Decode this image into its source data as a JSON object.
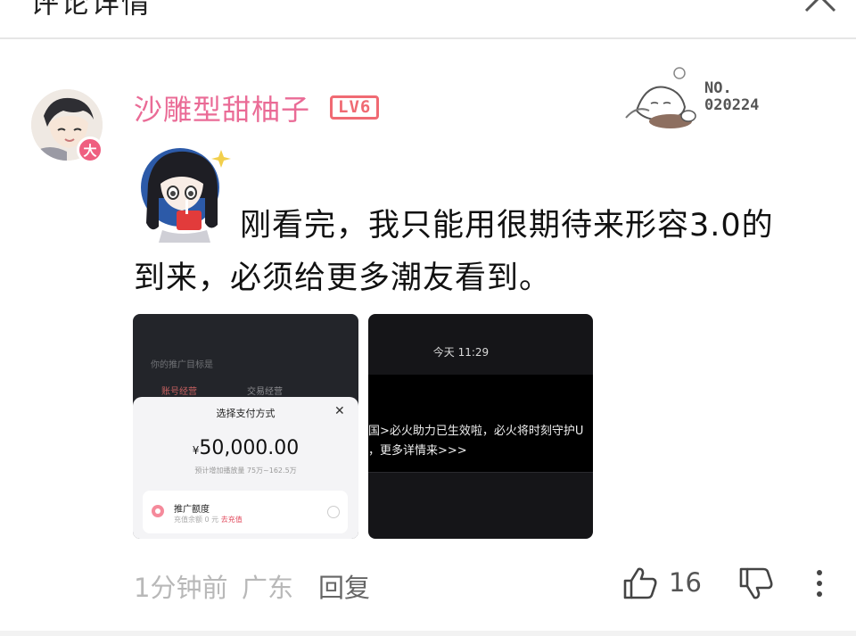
{
  "header": {
    "title": "评论详情"
  },
  "comment": {
    "user": {
      "name": "沙雕型甜柚子",
      "level": "LV6",
      "badge": "大"
    },
    "fan_badge": {
      "line1": "NO.",
      "line2": "020224"
    },
    "text_line1": "刚看完，我只能用很期待来形容3.0的",
    "text_line2": "到来，必须给更多潮友看到。",
    "images": [
      {
        "bg_line1": "你的推广目标是",
        "bg_tab1": "账号经营",
        "bg_tab2": "交易经营",
        "sheet_title": "选择支付方式",
        "currency": "¥",
        "amount": "50,000.00",
        "estimate": "预计增加播放量 75万~162.5万",
        "card_title": "推广额度",
        "card_balance_label": "充值余额 0 元",
        "card_link": "去充值"
      },
      {
        "time": "今天 11:29",
        "line1": "国>必火助力已生效啦，必火将时刻守护U",
        "line2": "，更多详情来>>>"
      }
    ],
    "time_ago": "1分钟前",
    "region": "广东",
    "reply_label": "回复",
    "like_count": "16"
  }
}
